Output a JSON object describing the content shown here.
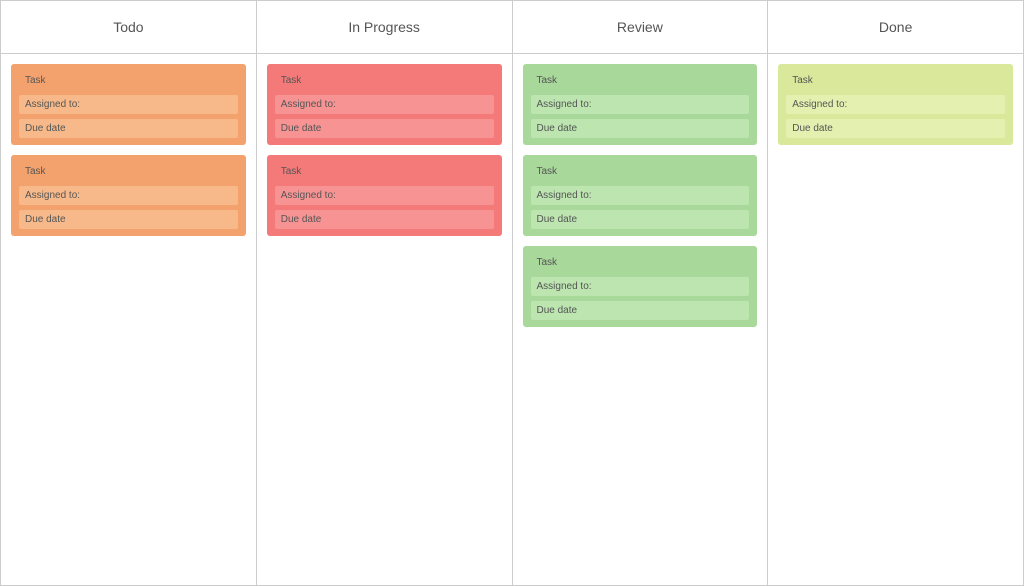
{
  "columns": [
    {
      "id": "todo",
      "label": "Todo",
      "colorClass": "col-todo",
      "cards": [
        {
          "task": "Task",
          "assigned": "Assigned to:",
          "due": "Due date"
        },
        {
          "task": "Task",
          "assigned": "Assigned to:",
          "due": "Due date"
        }
      ]
    },
    {
      "id": "inprogress",
      "label": "In Progress",
      "colorClass": "col-inprogress",
      "cards": [
        {
          "task": "Task",
          "assigned": "Assigned to:",
          "due": "Due date"
        },
        {
          "task": "Task",
          "assigned": "Assigned to:",
          "due": "Due date"
        }
      ]
    },
    {
      "id": "review",
      "label": "Review",
      "colorClass": "col-review",
      "cards": [
        {
          "task": "Task",
          "assigned": "Assigned to:",
          "due": "Due date"
        },
        {
          "task": "Task",
          "assigned": "Assigned to:",
          "due": "Due date"
        },
        {
          "task": "Task",
          "assigned": "Assigned to:",
          "due": "Due date"
        }
      ]
    },
    {
      "id": "done",
      "label": "Done",
      "colorClass": "col-done",
      "cards": [
        {
          "task": "Task",
          "assigned": "Assigned to:",
          "due": "Due date"
        }
      ]
    }
  ]
}
